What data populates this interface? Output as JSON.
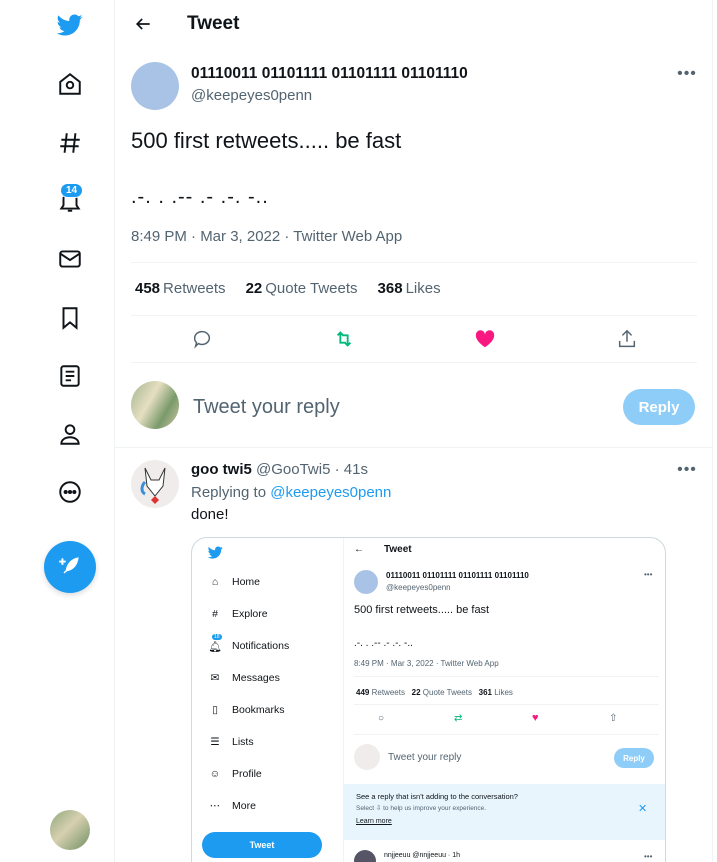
{
  "nav": {
    "notifications_badge": "14"
  },
  "header": {
    "title": "Tweet"
  },
  "tweet": {
    "display_name": "01110011 01101111 01101111 01101110",
    "handle": "@keepeyes0penn",
    "text": "500 first retweets..... be fast",
    "morse": ".-. . .-- .- .-. -..",
    "meta": "8:49 PM · Mar 3, 2022 · Twitter Web App",
    "stats": {
      "retweets_count": "458",
      "retweets_label": "Retweets",
      "quotes_count": "22",
      "quotes_label": "Quote Tweets",
      "likes_count": "368",
      "likes_label": "Likes"
    }
  },
  "compose_reply": {
    "placeholder": "Tweet your reply",
    "button_label": "Reply"
  },
  "reply": {
    "display_name": "goo twi5",
    "handle": "@GooTwi5",
    "time": "· 41s",
    "replying_to_label": "Replying to",
    "replying_to_handle": "@keepeyes0penn",
    "text": "done!"
  },
  "embedded": {
    "nav_items": [
      "Home",
      "Explore",
      "Notifications",
      "Messages",
      "Bookmarks",
      "Lists",
      "Profile",
      "More"
    ],
    "badge": "18",
    "tweet_button": "Tweet",
    "header_title": "Tweet",
    "display_name": "01110011 01101111 01101111 01101110",
    "handle": "@keepeyes0penn",
    "text": "500 first retweets..... be fast",
    "morse": ".-. . .-- .- .-. -..",
    "meta": "8:49 PM · Mar 3, 2022 · Twitter Web App",
    "retweets_count": "449",
    "retweets_label": "Retweets",
    "quotes_count": "22",
    "quotes_label": "Quote Tweets",
    "likes_count": "361",
    "likes_label": "Likes",
    "reply_placeholder": "Tweet your reply",
    "reply_button": "Reply",
    "notice_title": "See a reply that isn't adding to the conversation?",
    "notice_body": "Select ⇩ to help us improve your experience.",
    "notice_link": "Learn more",
    "next_reply": "nnjjeeuu @nnjjeeuu · 1h"
  },
  "colors": {
    "accent": "#1d9bf0",
    "retweet": "#00ba7c",
    "like": "#f91880"
  }
}
